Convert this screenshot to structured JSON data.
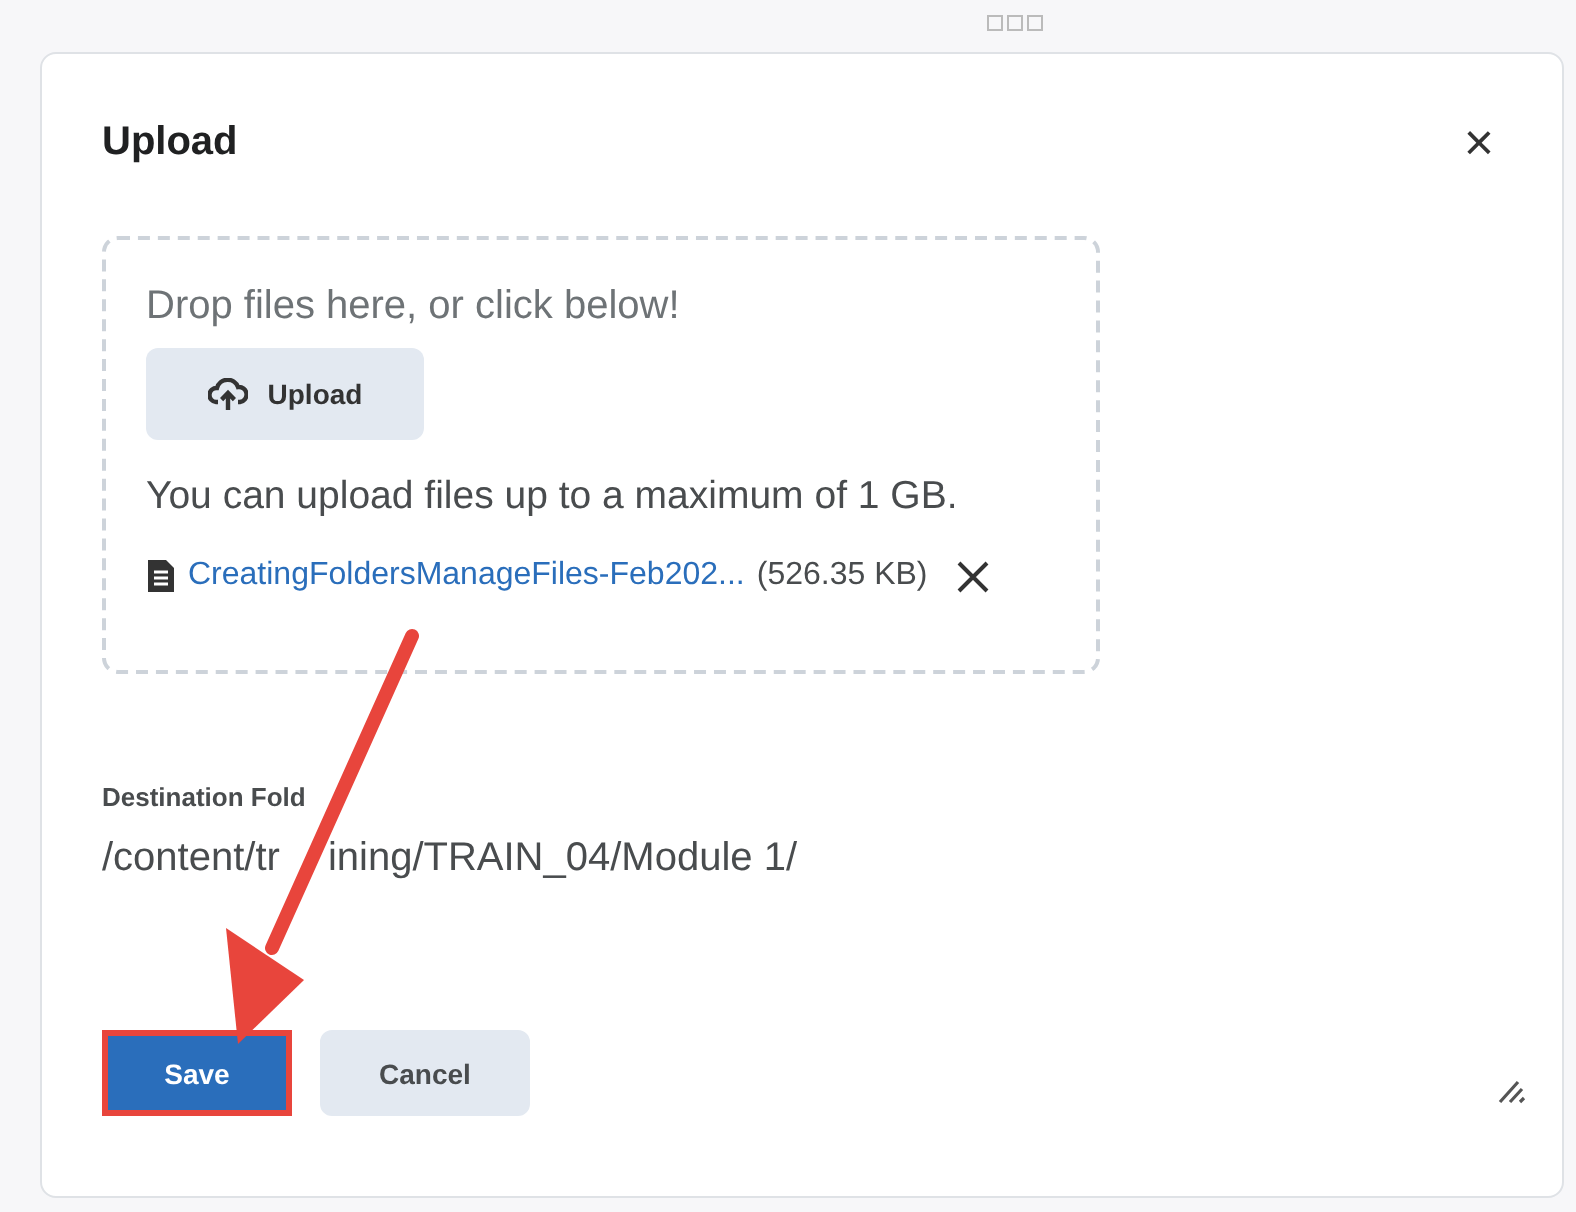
{
  "dialog": {
    "title": "Upload",
    "close": "×"
  },
  "dropzone": {
    "prompt": "Drop files here, or click below!",
    "button": "Upload",
    "limit": "You can upload files up to a maximum of 1 GB."
  },
  "files": [
    {
      "name": "CreatingFoldersManageFiles-Feb202...",
      "size": "(526.35 KB)"
    }
  ],
  "destination": {
    "label": "Destination Fold",
    "path_parts": [
      "/content/tr",
      "ining/TRAIN_04/Module 1/"
    ]
  },
  "buttons": [
    {
      "label": "Save",
      "kind": "primary"
    },
    {
      "label": "Cancel",
      "kind": "secondary"
    }
  ]
}
